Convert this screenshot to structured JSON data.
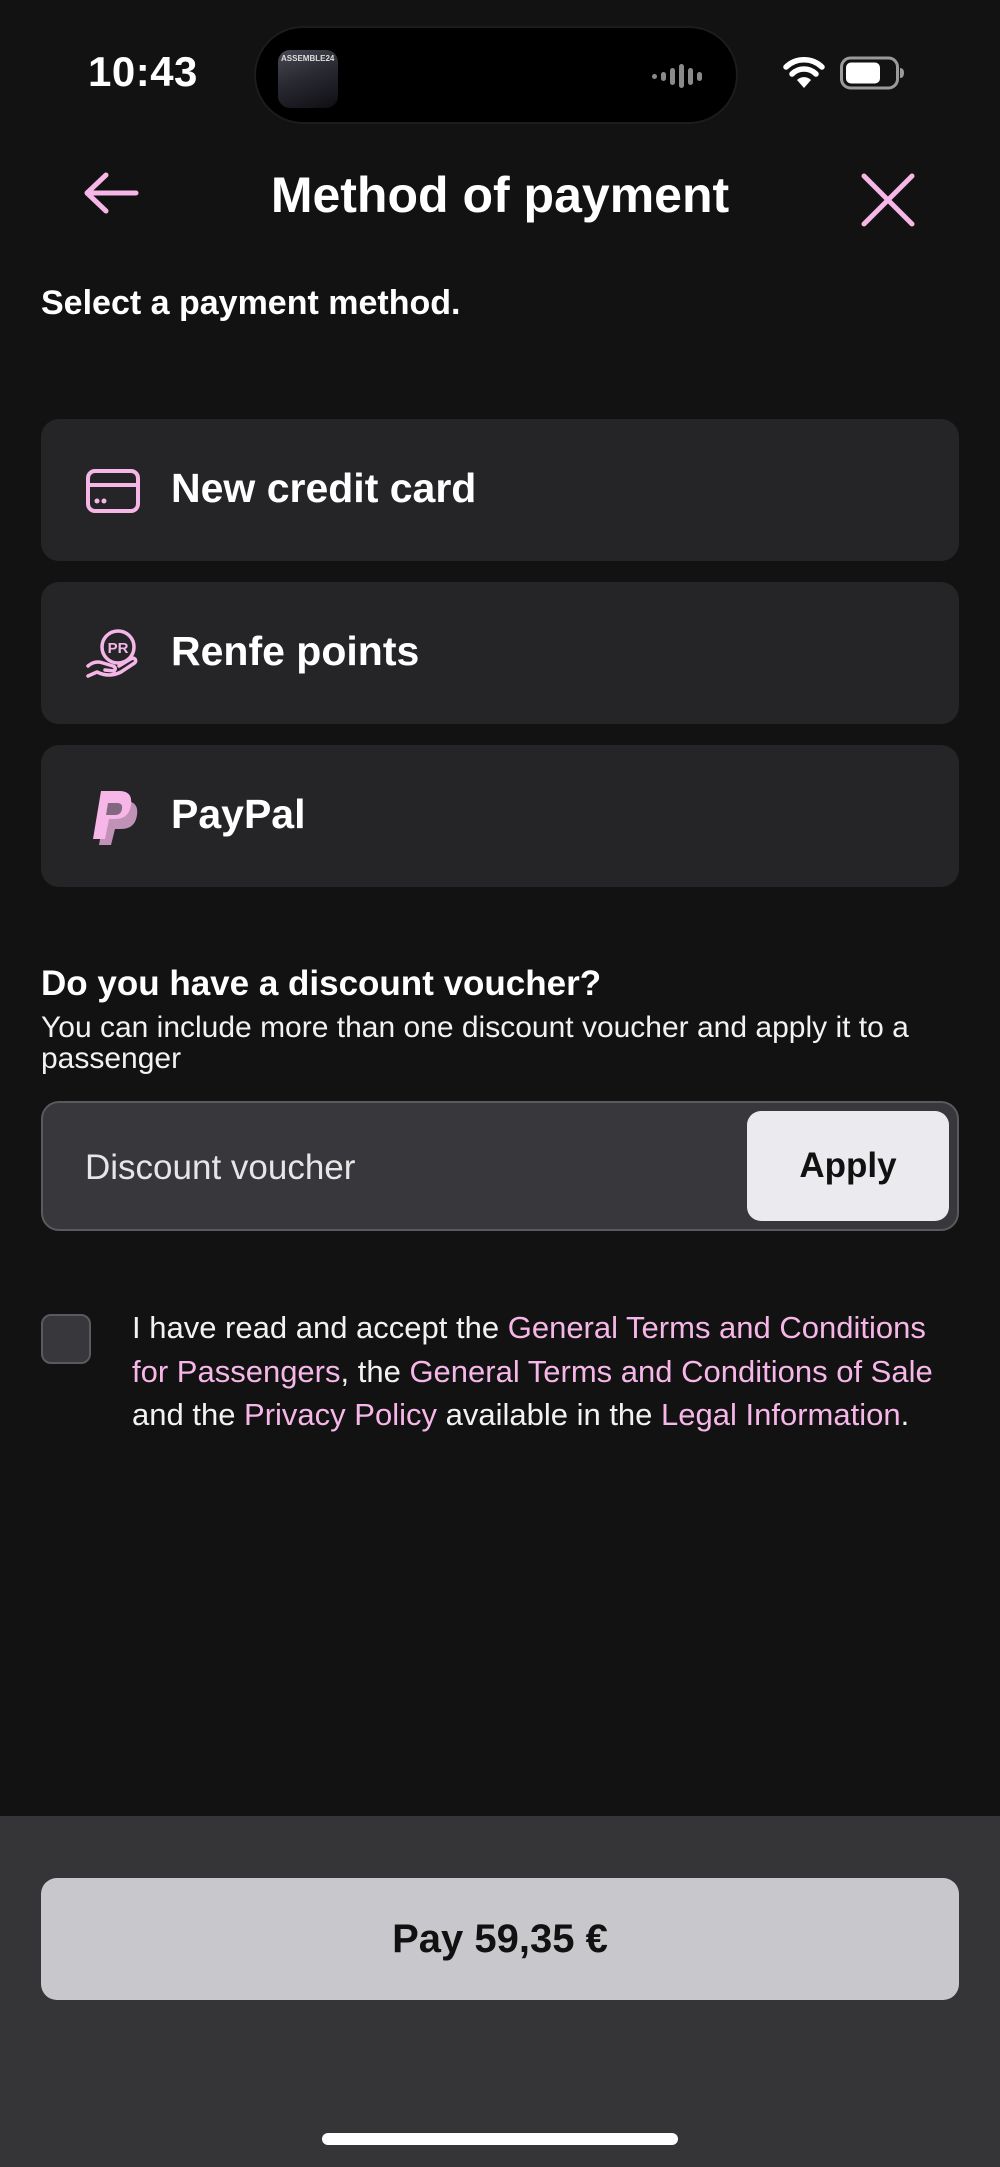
{
  "status_bar": {
    "time": "10:43",
    "island_thumb_text": "ASSEMBLE24"
  },
  "header": {
    "title": "Method of payment"
  },
  "subtitle": "Select a payment method.",
  "payment_methods": [
    {
      "label": "New credit card",
      "icon": "credit-card-icon"
    },
    {
      "label": "Renfe points",
      "icon": "renfe-points-icon",
      "icon_text": "PR"
    },
    {
      "label": "PayPal",
      "icon": "paypal-icon"
    }
  ],
  "voucher": {
    "heading": "Do you have a discount voucher?",
    "description": "You can include more than one discount voucher and apply it to a passenger",
    "placeholder": "Discount voucher",
    "apply_label": "Apply"
  },
  "terms": {
    "text_1": "I have read and accept the ",
    "link_1": "General Terms and Conditions for Passengers",
    "text_2": ", the ",
    "link_2": "General Terms and Conditions of Sale",
    "text_3": " and the ",
    "link_3": "Privacy Policy",
    "text_4": " available in the ",
    "link_4": "Legal Information",
    "text_5": "."
  },
  "footer": {
    "pay_label": "Pay 59,35 €"
  },
  "colors": {
    "background": "#121212",
    "accent_pink": "#f6b7e8",
    "card_background": "#252528",
    "pay_button": "#c8c8cc"
  }
}
